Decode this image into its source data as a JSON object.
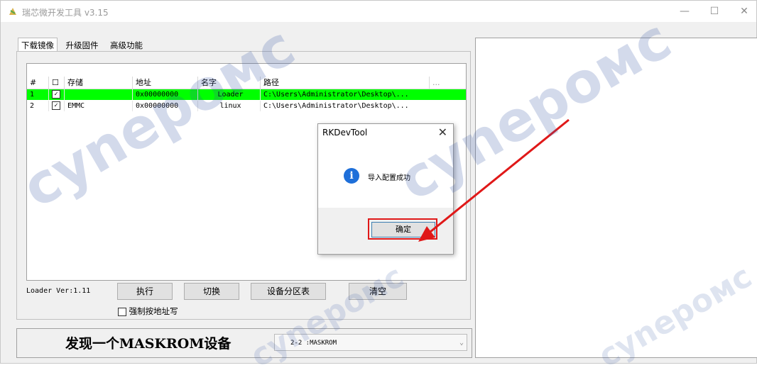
{
  "window": {
    "title": "瑞芯微开发工具 v3.15",
    "minimize": "—",
    "maximize": "☐",
    "close": "✕"
  },
  "tabs": [
    "下载镜像",
    "升级固件",
    "高级功能"
  ],
  "table": {
    "headers": [
      "#",
      "☐",
      "存储",
      "地址",
      "名字",
      "路径",
      "..."
    ],
    "rows": [
      {
        "index": "1",
        "checked": "✓",
        "storage": "",
        "address": "0x00000000",
        "name": "Loader",
        "path": "C:\\Users\\Administrator\\Desktop\\...",
        "selected": true
      },
      {
        "index": "2",
        "checked": "✓",
        "storage": "EMMC",
        "address": "0x00000000",
        "name": "linux",
        "path": "C:\\Users\\Administrator\\Desktop\\...",
        "selected": false
      }
    ]
  },
  "loader_version": "Loader Ver:1.11",
  "buttons": {
    "run": "执行",
    "switch": "切换",
    "partition_table": "设备分区表",
    "clear": "清空"
  },
  "force_write_label": "强制按地址写",
  "status": {
    "text": "发现一个MASKROM设备",
    "combo_value": "2-2 :MASKROM"
  },
  "dialog": {
    "title": "RKDevTool",
    "message": "导入配置成功",
    "ok_label": "确定",
    "close": "✕"
  },
  "watermark": "cynepoмc",
  "colors": {
    "selected_row": "#00ff00",
    "info_icon": "#1e6fd9",
    "highlight_box": "#e01818",
    "arrow": "#e01818"
  }
}
